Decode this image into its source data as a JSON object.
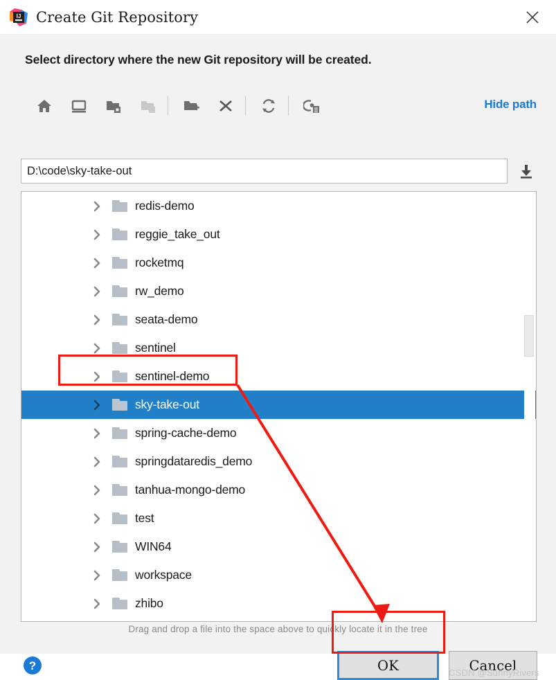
{
  "window": {
    "title": "Create Git Repository",
    "app_icon": "intellij-idea-icon",
    "close_icon": "close-icon"
  },
  "dialog": {
    "prompt": "Select directory where the new Git repository will be created.",
    "hint": "Drag and drop a file into the space above to quickly locate it in the tree"
  },
  "toolbar": {
    "hide_path_label": "Hide path",
    "buttons": [
      {
        "name": "home-icon",
        "tooltip": "Home"
      },
      {
        "name": "desktop-icon",
        "tooltip": "Desktop"
      },
      {
        "name": "folder-expand-icon",
        "tooltip": "Expand"
      },
      {
        "name": "folder-collapse-icon",
        "tooltip": "Collapse"
      },
      {
        "name": "new-folder-icon",
        "tooltip": "New Folder"
      },
      {
        "name": "delete-icon",
        "tooltip": "Delete"
      },
      {
        "name": "refresh-icon",
        "tooltip": "Refresh"
      },
      {
        "name": "show-hidden-files-icon",
        "tooltip": "Show Hidden Files and Directories"
      }
    ]
  },
  "path": {
    "value": "D:\\code\\sky-take-out",
    "placeholder": "",
    "download_icon": "arrow-to-line-icon"
  },
  "tree": {
    "items": [
      {
        "label": "redis-demo",
        "selected": false
      },
      {
        "label": "reggie_take_out",
        "selected": false
      },
      {
        "label": "rocketmq",
        "selected": false
      },
      {
        "label": "rw_demo",
        "selected": false
      },
      {
        "label": "seata-demo",
        "selected": false
      },
      {
        "label": "sentinel",
        "selected": false
      },
      {
        "label": "sentinel-demo",
        "selected": false
      },
      {
        "label": "sky-take-out",
        "selected": true
      },
      {
        "label": "spring-cache-demo",
        "selected": false
      },
      {
        "label": "springdataredis_demo",
        "selected": false
      },
      {
        "label": "tanhua-mongo-demo",
        "selected": false
      },
      {
        "label": "test",
        "selected": false
      },
      {
        "label": "WIN64",
        "selected": false
      },
      {
        "label": "workspace",
        "selected": false
      },
      {
        "label": "zhibo",
        "selected": false
      }
    ]
  },
  "footer": {
    "help_icon": "help-icon",
    "ok_label": "OK",
    "cancel_label": "Cancel"
  },
  "watermark": "CSDN @SunnyRivers",
  "colors": {
    "selection_blue": "#2280c8",
    "link_blue": "#1b7ad6",
    "focus_blue": "#2f8ad8",
    "annotation_red": "#ee1b13",
    "dialog_bg": "#f2f2f2"
  }
}
